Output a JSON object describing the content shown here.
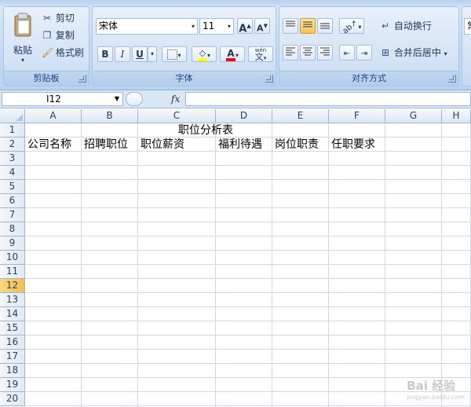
{
  "ribbon": {
    "clipboard": {
      "paste_label": "粘贴",
      "cut_label": "剪切",
      "copy_label": "复制",
      "format_painter_label": "格式刷",
      "group_label": "剪贴板"
    },
    "font": {
      "font_name": "宋体",
      "font_size": "11",
      "grow_label": "A",
      "shrink_label": "A",
      "bold_label": "B",
      "italic_label": "I",
      "underline_label": "U",
      "phonetic_label": "文",
      "phonetic_top": "wén",
      "group_label": "字体",
      "fill_color": "#ffff00",
      "font_color": "#ff0000"
    },
    "alignment": {
      "wrap_text_label": "自动换行",
      "merge_center_label": "合并后居中",
      "group_label": "对齐方式"
    },
    "number": {
      "partial_label": "常"
    }
  },
  "formula_bar": {
    "name_box": "I12",
    "fx_label": "fx",
    "formula": ""
  },
  "sheet": {
    "columns": [
      "A",
      "B",
      "C",
      "D",
      "E",
      "F",
      "G",
      "H"
    ],
    "rows": [
      "1",
      "2",
      "3",
      "4",
      "5",
      "6",
      "7",
      "8",
      "9",
      "10",
      "11",
      "12",
      "13",
      "14",
      "15",
      "16",
      "17",
      "18",
      "19",
      "20"
    ],
    "selected_row": "12",
    "title": "职位分析表",
    "headers": [
      "公司名称",
      "招聘职位",
      "职位薪资",
      "福利待遇",
      "岗位职责",
      "任职要求"
    ]
  },
  "watermark": {
    "text": "Bai 经验",
    "url": "jingyan.baidu.com"
  }
}
